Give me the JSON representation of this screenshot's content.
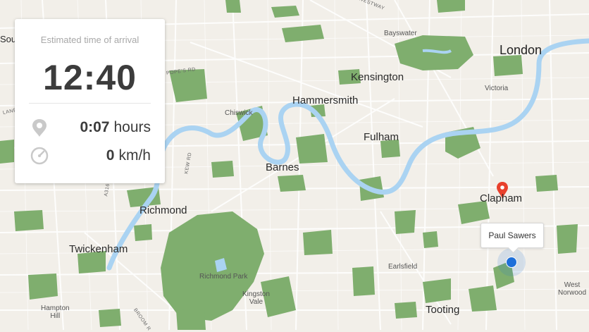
{
  "map": {
    "places": {
      "london": "London",
      "bayswater": "Bayswater",
      "kensington": "Kensington",
      "victoria": "Victoria",
      "hammersmith": "Hammersmith",
      "chiswick": "Chiswick",
      "fulham": "Fulham",
      "barnes": "Barnes",
      "clapham": "Clapham",
      "richmond": "Richmond",
      "twickenham": "Twickenham",
      "richmond_park": "Richmond Park",
      "kingston_vale": "Kingston\nVale",
      "earlsfield": "Earlsfield",
      "tooting": "Tooting",
      "hampton_hill": "Hampton\nHill",
      "west_norwood": "West\nNorwood",
      "south_edge": "Sou",
      "westway": "WESTWAY",
      "popes_road": "POPE'S RD",
      "kew_road": "KEW RD",
      "a316": "A316",
      "broom_road": "BROOM R",
      "lane": "LANE"
    },
    "colors": {
      "background": "#f2efe9",
      "water": "#aad3f2",
      "park": "#7fae6e",
      "road": "#ffffff",
      "destination_pin": "#e8402c",
      "current_location": "#1e6fd9"
    }
  },
  "eta_card": {
    "title": "Estimated time of arrival",
    "time": "12:40",
    "duration_value": "0:07",
    "duration_unit": "hours",
    "speed_value": "0",
    "speed_unit": "km/h",
    "duration_icon": "location-pin-icon",
    "speed_icon": "speedometer-icon"
  },
  "user_marker": {
    "label": "Paul Sawers"
  },
  "destination_marker": {
    "icon": "map-pin-icon"
  }
}
